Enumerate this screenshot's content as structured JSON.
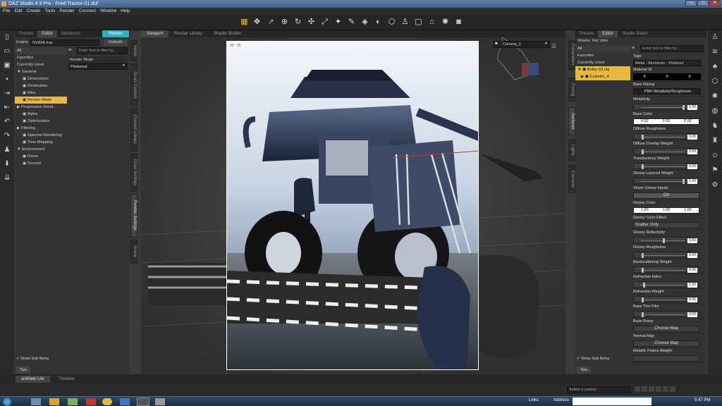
{
  "window": {
    "title": "DAZ Studio 4.9 Pro - Fred-Tractor-01.duf",
    "buttons": [
      "—",
      "□",
      "✕"
    ]
  },
  "menu": [
    "File",
    "Edit",
    "Create",
    "Tools",
    "Render",
    "Connect",
    "Window",
    "Help"
  ],
  "toolbar_icons": [
    "render-settings-icon",
    "universal-tool-icon",
    "render-icon",
    "select-icon",
    "translate-icon",
    "rotate-icon",
    "scale-icon",
    "transform-icon",
    "joint-editor-icon",
    "node-weight-icon",
    "surface-selection-icon",
    "spot-render-icon",
    "geometry-editor-icon",
    "active-pose-icon",
    "camera-icon"
  ],
  "left_panel": {
    "tabs": [
      "Presets",
      "Editor",
      "Advanced"
    ],
    "render_button": "Render",
    "engine_label": "Engine",
    "engine_value": "NVIDIA Iray",
    "defaults_button": "Defaults",
    "filter_placeholder": "Enter text to filter by...",
    "categories": [
      "All",
      "Favorites",
      "Currently Used"
    ],
    "tree": [
      {
        "label": "General",
        "depth": 0,
        "arrow": "▼"
      },
      {
        "label": "Dimensions",
        "depth": 1
      },
      {
        "label": "Destination",
        "depth": 1
      },
      {
        "label": "Misc",
        "depth": 1
      },
      {
        "label": "Render Mode",
        "depth": 1,
        "selected": true
      },
      {
        "label": "Progressive Rend...",
        "depth": 0,
        "arrow": "▶"
      },
      {
        "label": "Alpha",
        "depth": 1
      },
      {
        "label": "Optimization",
        "depth": 1
      },
      {
        "label": "Filtering",
        "depth": 0,
        "arrow": "▶"
      },
      {
        "label": "Spectral Rendering",
        "depth": 1
      },
      {
        "label": "Tone Mapping",
        "depth": 1
      },
      {
        "label": "Environment",
        "depth": 0,
        "arrow": "▼"
      },
      {
        "label": "Dome",
        "depth": 1
      },
      {
        "label": "Ground",
        "depth": 1
      }
    ],
    "render_mode_label": "Render Mode",
    "render_mode_value": "Photoreal",
    "show_sub_items": "Show Sub Items",
    "tips": "Tips"
  },
  "left_side_tabs": [
    "Install",
    "Smart Content",
    "Content Library",
    "Draw Settings",
    "Render Settings",
    "Scene"
  ],
  "viewport": {
    "tabs": [
      "Viewport",
      "Render Library",
      "Shader Builder"
    ],
    "camera": "Camera_1",
    "render_tag": "00 : 15"
  },
  "right_side_tabs": [
    "Parameters",
    "Posing",
    "Surfaces",
    "Lights",
    "Cameras"
  ],
  "right_panel": {
    "tabs": [
      "Presets",
      "Editor",
      "Shader Baker"
    ],
    "shader_label": "Shader: Iray Uber",
    "categories": [
      "All",
      "Favorites",
      "Currently Used"
    ],
    "filter_placeholder": "Enter text to filter by...",
    "scene_items": [
      {
        "label": "Bolby-03.obj",
        "depth": 0
      },
      {
        "label": "Cylinder_4",
        "depth": 1
      }
    ],
    "tags_label": "Tags",
    "tags_value": "Metal - Aluminum - Polished",
    "material_id_label": "Material ID",
    "material_id_values": [
      "0",
      "0",
      "0"
    ],
    "base_mixing_label": "Base Mixing",
    "base_mixing_value": "PBR Metallicity/Roughness",
    "properties": [
      {
        "label": "Metallicity",
        "value": "1.00",
        "knob": 0.95
      },
      {
        "label": "Base Color",
        "triple": [
          "0.92",
          "0.92",
          "0.92"
        ]
      },
      {
        "label": "Diffuse Roughness",
        "value": "0.00",
        "knob": 0.02
      },
      {
        "label": "Diffuse Overlay Weight",
        "value": "0.00",
        "knob": 0.02
      },
      {
        "label": "Translucency Weight",
        "value": "0.00",
        "knob": 0.02
      },
      {
        "label": "Glossy Layered Weight",
        "value": "1.00",
        "knob": 0.95
      },
      {
        "label": "Share Glossy Inputs",
        "toggle": "On"
      },
      {
        "label": "Glossy Color",
        "triple": [
          "1.00",
          "1.00",
          "1.00"
        ]
      },
      {
        "label": "Glossy Color Effect",
        "dropdown": "Scatter Only"
      },
      {
        "label": "Glossy Reflectivity",
        "value": "0.50",
        "knob": 0.5
      },
      {
        "label": "Glossy Roughness",
        "value": "0.00",
        "knob": 0.02
      },
      {
        "label": "Backscattering Weight",
        "value": "0.00",
        "knob": 0.02
      },
      {
        "label": "Refraction Index",
        "value": "1.50",
        "knob": 0.05
      },
      {
        "label": "Refraction Weight",
        "value": "0.00",
        "knob": 0.02
      },
      {
        "label": "Base Thin Film",
        "value": "0.00",
        "knob": 0.02
      },
      {
        "label": "Base Bump",
        "map": "Choose Map"
      },
      {
        "label": "Normal Map",
        "map": "Choose Map"
      },
      {
        "label": "Metallic Flakes Weight"
      }
    ],
    "show_sub_items": "Show Sub Items",
    "tips": "Tips"
  },
  "bottom_tabs": [
    "aniMate Lite",
    "Timeline"
  ],
  "lesson": {
    "placeholder": "Select a Lesson"
  },
  "taskbar": {
    "links": "Links",
    "address": "Address",
    "time": "5:47 PM"
  }
}
